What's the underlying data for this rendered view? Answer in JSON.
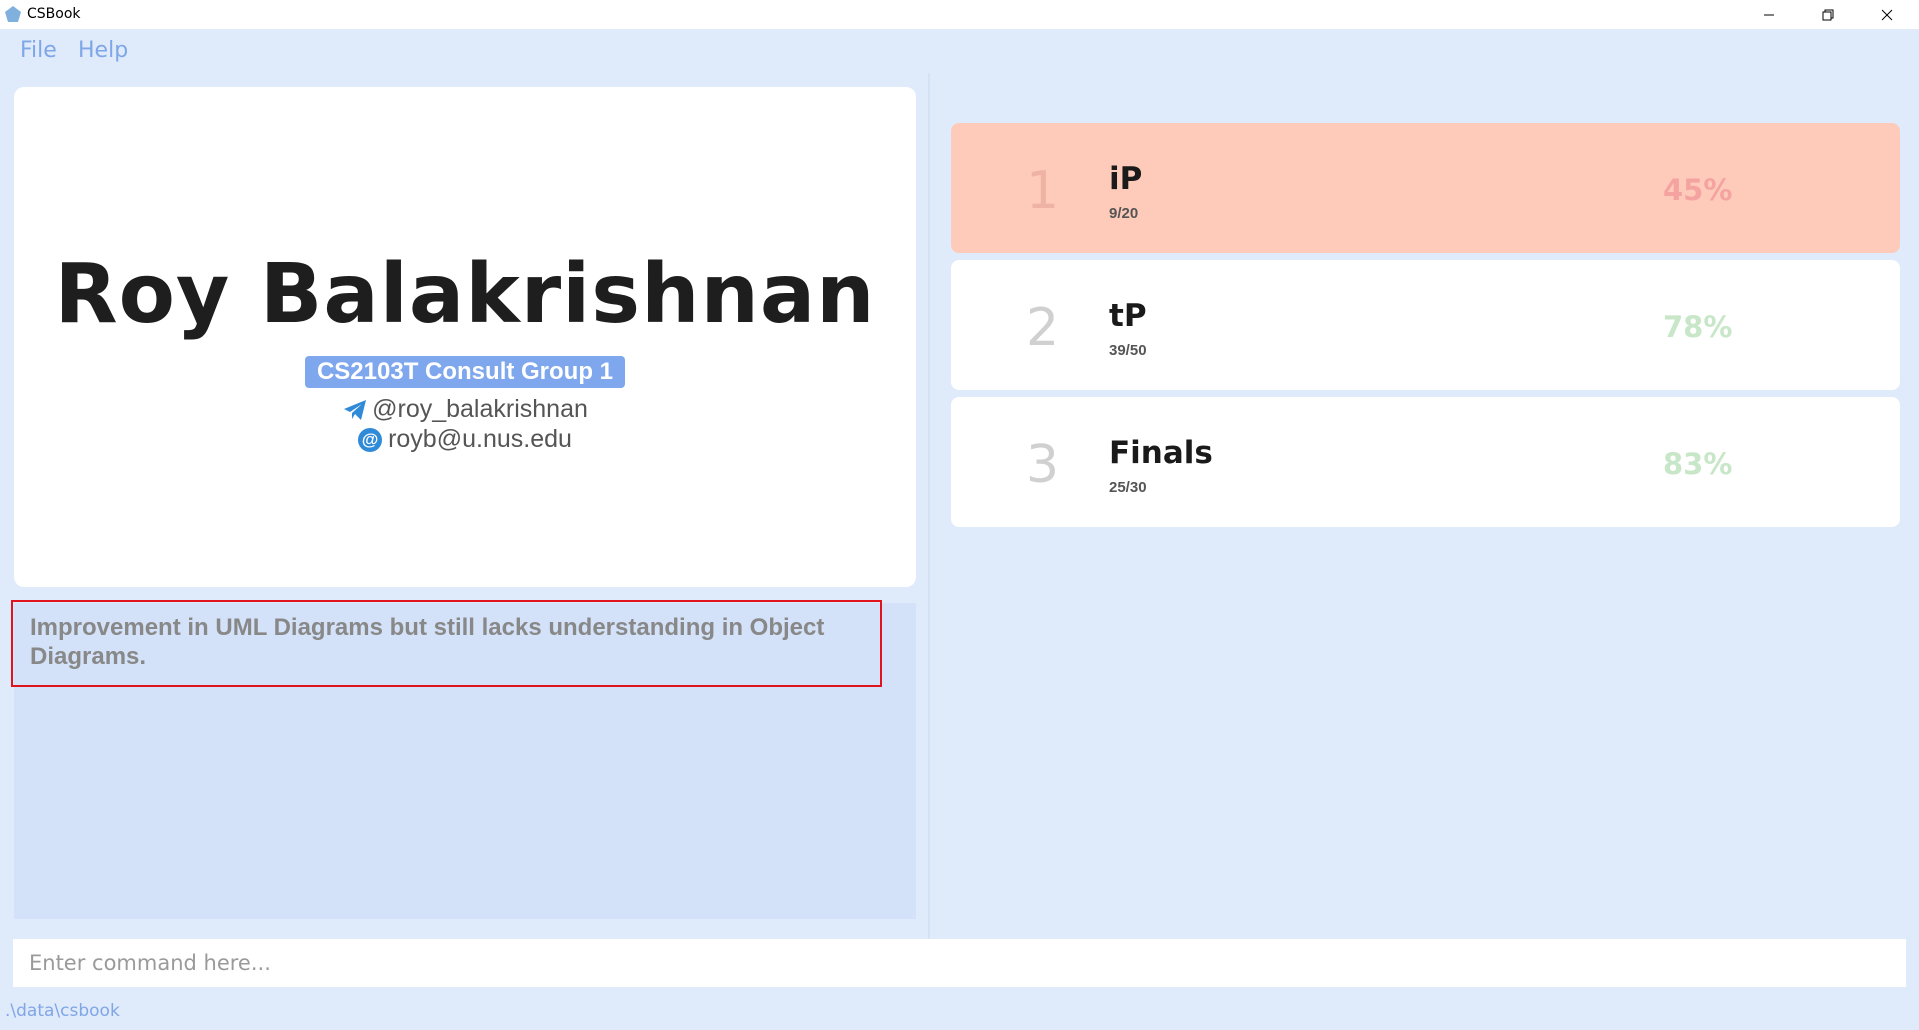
{
  "window": {
    "title": "CSBook",
    "minimize_label": "",
    "maximize_label": "",
    "close_label": ""
  },
  "menu": {
    "items": [
      {
        "label": "File"
      },
      {
        "label": "Help"
      }
    ]
  },
  "profile": {
    "name": "Roy Balakrishnan",
    "group": "CS2103T Consult Group 1",
    "telegram": "@roy_balakrishnan",
    "email": "royb@u.nus.edu",
    "email_icon_glyph": "@"
  },
  "remark": {
    "text": "Improvement in UML Diagrams but still lacks understanding in Object Diagrams."
  },
  "grades": [
    {
      "index": "1",
      "name": "iP",
      "score": "9/20",
      "percent": "45%",
      "percent_value": 45,
      "status": "low",
      "card_color": "#fecbba",
      "percent_color": "#f5a3a0"
    },
    {
      "index": "2",
      "name": "tP",
      "score": "39/50",
      "percent": "78%",
      "percent_value": 78,
      "status": "ok",
      "card_color": "#ffffff",
      "percent_color": "#c8e6c8"
    },
    {
      "index": "3",
      "name": "Finals",
      "score": "25/30",
      "percent": "83%",
      "percent_value": 83,
      "status": "ok",
      "card_color": "#ffffff",
      "percent_color": "#c8e6c8"
    }
  ],
  "command": {
    "placeholder": "Enter command here...",
    "value": ""
  },
  "status": {
    "path": ".\\data\\csbook"
  },
  "colors": {
    "background": "#dfeafb",
    "accent": "#7fa6e6",
    "group_badge": "#7fa7ee",
    "highlight_border": "#e0141e"
  }
}
